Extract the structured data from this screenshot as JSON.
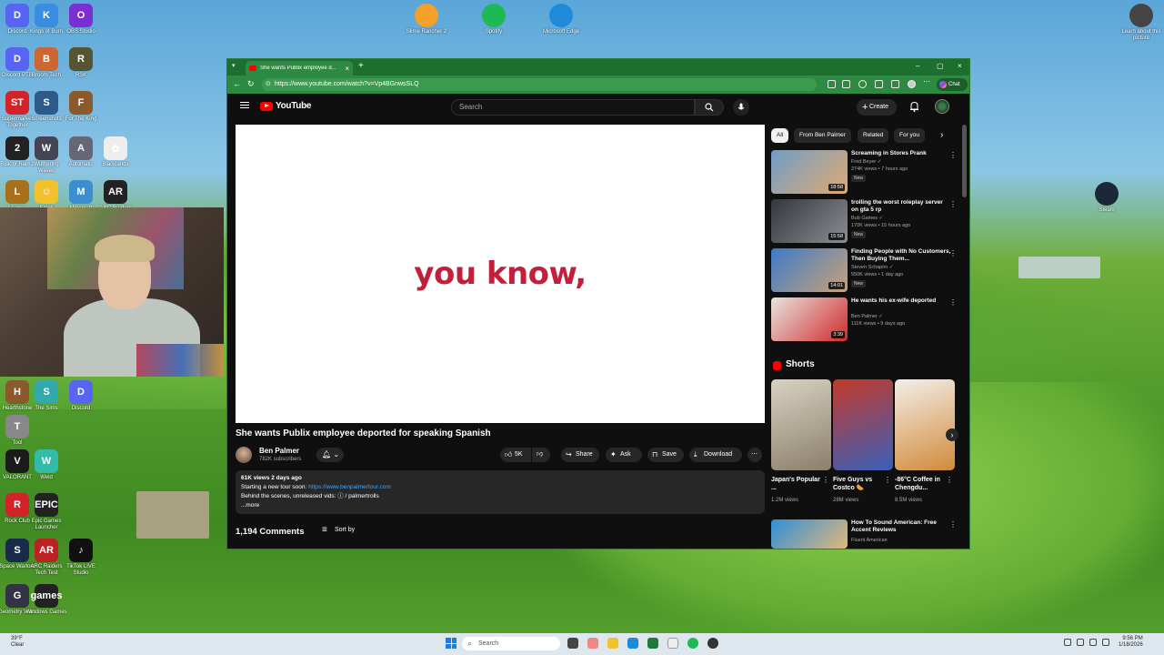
{
  "desktop": {
    "icons": [
      {
        "label": "Discord",
        "color": "#5865f2",
        "glyph": "D"
      },
      {
        "label": "Kings of Burn",
        "color": "#3a8de0",
        "glyph": "K"
      },
      {
        "label": "OBS Studio",
        "color": "#7b2fd1",
        "glyph": "O"
      },
      {
        "label": "Discord PTB",
        "color": "#5865f2",
        "glyph": "D"
      },
      {
        "label": "Broom Tech",
        "color": "#c63",
        "glyph": "B"
      },
      {
        "label": "RSK",
        "color": "#553",
        "glyph": "R"
      },
      {
        "label": "Supermarket Together",
        "color": "#d2232a",
        "glyph": "ST"
      },
      {
        "label": "Screenshots",
        "color": "#2d5a8a",
        "glyph": "S"
      },
      {
        "label": "For The King",
        "color": "#8a5a2d",
        "glyph": "F"
      },
      {
        "label": "Risk of Rain 2",
        "color": "#222",
        "glyph": "2"
      },
      {
        "label": "Wuthering Waves",
        "color": "#445",
        "glyph": "W"
      },
      {
        "label": "Automatic",
        "color": "#667",
        "glyph": "A"
      },
      {
        "label": "Blacklands",
        "color": "#eee",
        "glyph": "✿"
      },
      {
        "label": "League",
        "color": "#a86f1d",
        "glyph": "L"
      },
      {
        "label": "Emoji",
        "color": "#f2c12e",
        "glyph": "☺"
      },
      {
        "label": "Minecraft",
        "color": "#3b8fd0",
        "glyph": "M"
      },
      {
        "label": "ARC Raiders",
        "color": "#222",
        "glyph": "AR"
      },
      {
        "label": "Hearthstone",
        "color": "#8a5a2d",
        "glyph": "H"
      },
      {
        "label": "The Sims",
        "color": "#3aa",
        "glyph": "S"
      },
      {
        "label": "Discord",
        "color": "#5865f2",
        "glyph": "D"
      },
      {
        "label": "Tool",
        "color": "#888",
        "glyph": "T"
      },
      {
        "label": "VALORANT",
        "color": "#1b1b1b",
        "glyph": "V"
      },
      {
        "label": "Weld",
        "color": "#3ba",
        "glyph": "W"
      },
      {
        "label": "Rock Club",
        "color": "#d2232a",
        "glyph": "R"
      },
      {
        "label": "Epic Games Launcher",
        "color": "#222",
        "glyph": "EPIC"
      },
      {
        "label": "Space Warlord",
        "color": "#1a2a4a",
        "glyph": "S"
      },
      {
        "label": "ARC Raiders Tech Test",
        "color": "#b22",
        "glyph": "AR"
      },
      {
        "label": "TikTok LIVE Studio",
        "color": "#111",
        "glyph": "♪"
      },
      {
        "label": "Geometry Wars",
        "color": "#334",
        "glyph": "G"
      },
      {
        "label": "Windows Games",
        "color": "#222",
        "glyph": "games"
      }
    ],
    "top_icons": [
      {
        "label": "Slime Rancher 2",
        "color": "#f3a12a"
      },
      {
        "label": "Spotify",
        "color": "#1db954"
      },
      {
        "label": "Microsoft Edge",
        "color": "#1f8ad8"
      }
    ],
    "right_icons": [
      {
        "label": "Learn about this picture",
        "color": "#444"
      },
      {
        "label": "Steam",
        "color": "#1b2838"
      }
    ]
  },
  "browser": {
    "tab_title": "She wants Publix employee d...",
    "url": "https://www.youtube.com/watch?v=Vp4BGnwsSLQ",
    "copilot_label": "Chat"
  },
  "youtube": {
    "logo_text": "YouTube",
    "search_placeholder": "Search",
    "create_label": "Create",
    "video_caption": "you know,",
    "video_title": "She wants Publix employee deported for speaking Spanish",
    "channel_name": "Ben Palmer",
    "channel_subs": "782K subscribers",
    "likes": "5K",
    "share_label": "Share",
    "ask_label": "Ask",
    "save_label": "Save",
    "download_label": "Download",
    "desc_meta": "61K views  2 days ago",
    "desc_line1": "Starting a new tour soon: ",
    "desc_link": "https://www.benpalmertour.com",
    "desc_line2": "Behind the scenes, unreleased vids:  ⓘ / palmertrolls",
    "desc_more": "...more",
    "comments_count": "1,194 Comments",
    "sort_label": "Sort by",
    "chips": [
      "All",
      "From Ben Palmer",
      "Related",
      "For you"
    ],
    "recommendations": [
      {
        "title": "Screaming in Stores Prank",
        "channel": "Fred Beyer ✓",
        "views": "274K views • 7 hours ago",
        "badge": "New",
        "duration": "18:58",
        "color1": "#6f9ec9",
        "color2": "#e0a870"
      },
      {
        "title": "trolling the worst roleplay server on gta 5 rp",
        "channel": "Bub Games ✓",
        "views": "170K views • 15 hours ago",
        "badge": "New",
        "duration": "15:58",
        "color1": "#33363a",
        "color2": "#8a8f94"
      },
      {
        "title": "Finding People with No Customers, Then Buying Them...",
        "channel": "Steven Schapiro ✓",
        "views": "550K views • 1 day ago",
        "badge": "New",
        "duration": "14:01",
        "color1": "#3d7ac8",
        "color2": "#c9a27a"
      },
      {
        "title": "He wants his ex-wife deported",
        "channel": "Ben Palmer ✓",
        "views": "111K views • 9 days ago",
        "badge": "",
        "duration": "3:39",
        "color1": "#e9e4e0",
        "color2": "#d02b2b"
      }
    ],
    "shorts_header": "Shorts",
    "shorts": [
      {
        "title": "Japan's Popular ...",
        "views": "1.2M views",
        "color1": "#d8d2c2",
        "color2": "#8a7f6a"
      },
      {
        "title": "Five Guys vs Costco 🌭",
        "views": "28M views",
        "color1": "#c33a2a",
        "color2": "#3a5fb8"
      },
      {
        "title": "-86°C Coffee in Chengdu...",
        "views": "8.5M views",
        "color1": "#f2efe8",
        "color2": "#d28a3a"
      }
    ],
    "last_rec": {
      "title": "How To Sound American: Free Accent Reviews",
      "channel": "Fluent American"
    }
  },
  "taskbar": {
    "weather_temp": "39°F",
    "weather_desc": "Clear",
    "search_label": "Search",
    "time": "9:56 PM",
    "date": "1/18/2026"
  }
}
